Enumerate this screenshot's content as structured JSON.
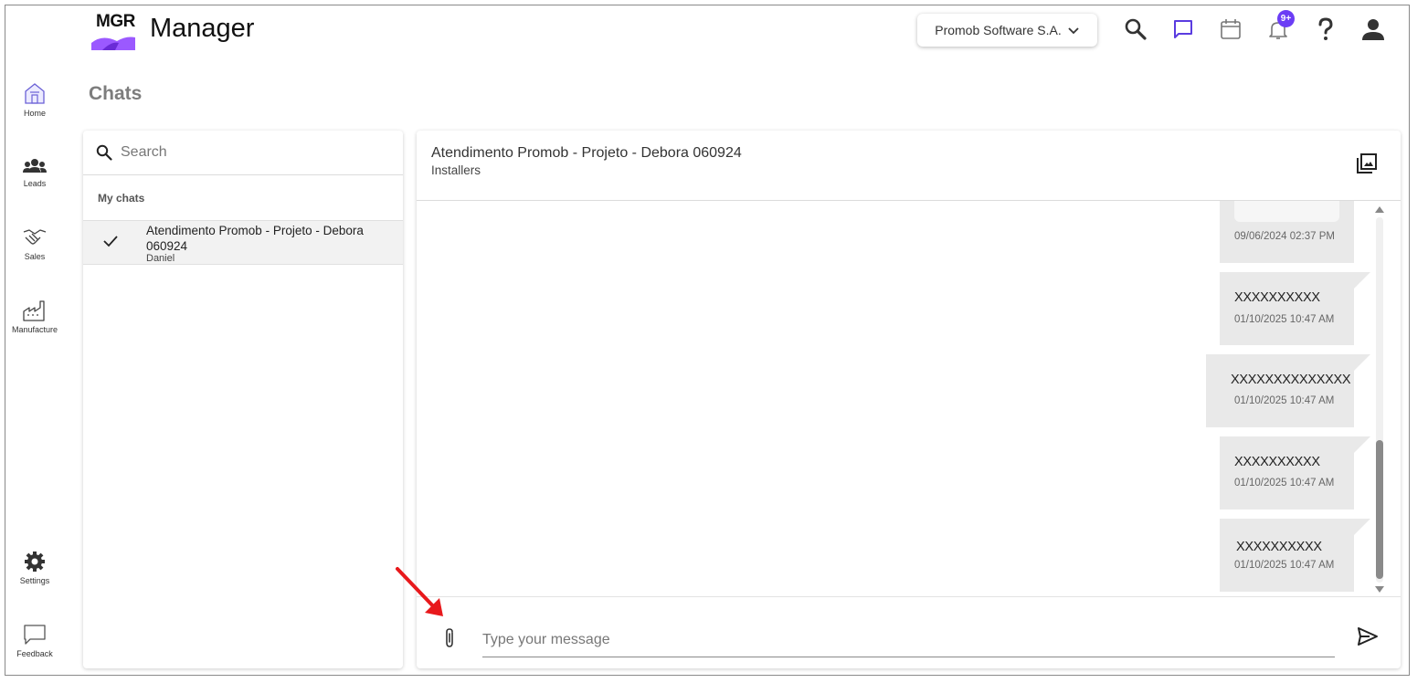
{
  "app": {
    "logo_text": "MGR",
    "title": "Manager"
  },
  "header": {
    "company_selector": "Promob Software S.A.",
    "notification_badge": "9+",
    "icons": [
      "search-icon",
      "chat-icon",
      "calendar-icon",
      "bell-icon",
      "help-icon",
      "user-icon"
    ],
    "accent_color": "#6b3df5"
  },
  "rail": {
    "home": "Home",
    "leads": "Leads",
    "sales": "Sales",
    "manufacture": "Manufacture",
    "settings": "Settings",
    "feedback": "Feedback"
  },
  "page": {
    "title": "Chats"
  },
  "chat_list": {
    "search_placeholder": "Search",
    "section_label": "My chats",
    "items": [
      {
        "title": "Atendimento Promob - Projeto - Debora 060924",
        "subtitle": "Daniel",
        "selected": true
      }
    ]
  },
  "conversation": {
    "title": "Atendimento Promob - Projeto - Debora 060924",
    "subtitle": "Installers",
    "messages": [
      {
        "text": "",
        "time": "09/06/2024 02:37 PM"
      },
      {
        "text": "XXXXXXXXXX",
        "time": "01/10/2025 10:47 AM"
      },
      {
        "text": "XXXXXXXXXXXXXX",
        "time": "01/10/2025 10:47 AM"
      },
      {
        "text": "XXXXXXXXXX",
        "time": "01/10/2025 10:47 AM"
      },
      {
        "text": "XXXXXXXXXX",
        "time": "01/10/2025 10:47 AM"
      }
    ],
    "input_placeholder": "Type your message",
    "bubble_color": "#e9e9e9"
  },
  "annotation": {
    "arrow_color": "#e8191c"
  }
}
